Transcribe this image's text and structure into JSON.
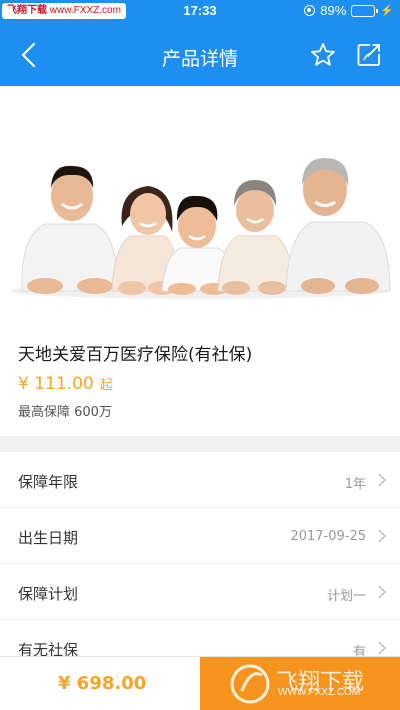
{
  "status_bar": {
    "watermark_brand": "飞翔下载",
    "watermark_url": "www.FXXZ.com",
    "time": "17:33",
    "battery": "89%",
    "battery_level": 0.89
  },
  "nav": {
    "title": "产品详情",
    "back_icon": "chevron-left-icon",
    "favorite_icon": "star-outline-icon",
    "share_icon": "share-edit-icon"
  },
  "product": {
    "name": "天地关爱百万医疗保险(有社保)",
    "price": "¥ 111.00",
    "price_suffix": "起",
    "max_coverage": "最高保障 600万"
  },
  "options": [
    {
      "label": "保障年限",
      "value": "1年"
    },
    {
      "label": "出生日期",
      "value": "2017-09-25"
    },
    {
      "label": "保障计划",
      "value": "计划一"
    },
    {
      "label": "有无社保",
      "value": "有"
    }
  ],
  "bottom": {
    "total": "¥ 698.00",
    "buy_label": "",
    "watermark_text": "飞翔下载",
    "watermark_url": "WWW.FXXZ.COM"
  },
  "colors": {
    "accent": "#1e8ff0",
    "price": "#f5a623",
    "buy_button": "#f7941e"
  }
}
